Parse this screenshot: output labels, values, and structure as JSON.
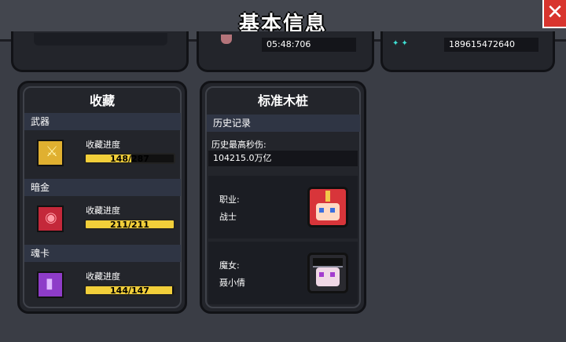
{
  "window": {
    "title": "基本信息",
    "close_glyph": "✕"
  },
  "top_row": {
    "time_value": "05:48:706",
    "id_value": "189615472640"
  },
  "collection": {
    "title": "收藏",
    "progress_label": "收藏进度",
    "items": [
      {
        "section": "武器",
        "progress": "148/287",
        "fraction": 0.516,
        "icon": "weapon-book-icon",
        "color": "#e0b030"
      },
      {
        "section": "暗金",
        "progress": "211/211",
        "fraction": 1.0,
        "icon": "dark-gold-book-icon",
        "color": "#c4283a"
      },
      {
        "section": "魂卡",
        "progress": "144/147",
        "fraction": 0.98,
        "icon": "soul-card-book-icon",
        "color": "#8e3cc8"
      }
    ]
  },
  "dummy": {
    "title": "标准木桩",
    "history_header": "历史记录",
    "highest_dps_label": "历史最高秒伤:",
    "highest_dps_value": "104215.0万亿",
    "class_label": "职业:",
    "class_value": "战士",
    "witch_label": "魔女:",
    "witch_value": "聂小倩"
  }
}
